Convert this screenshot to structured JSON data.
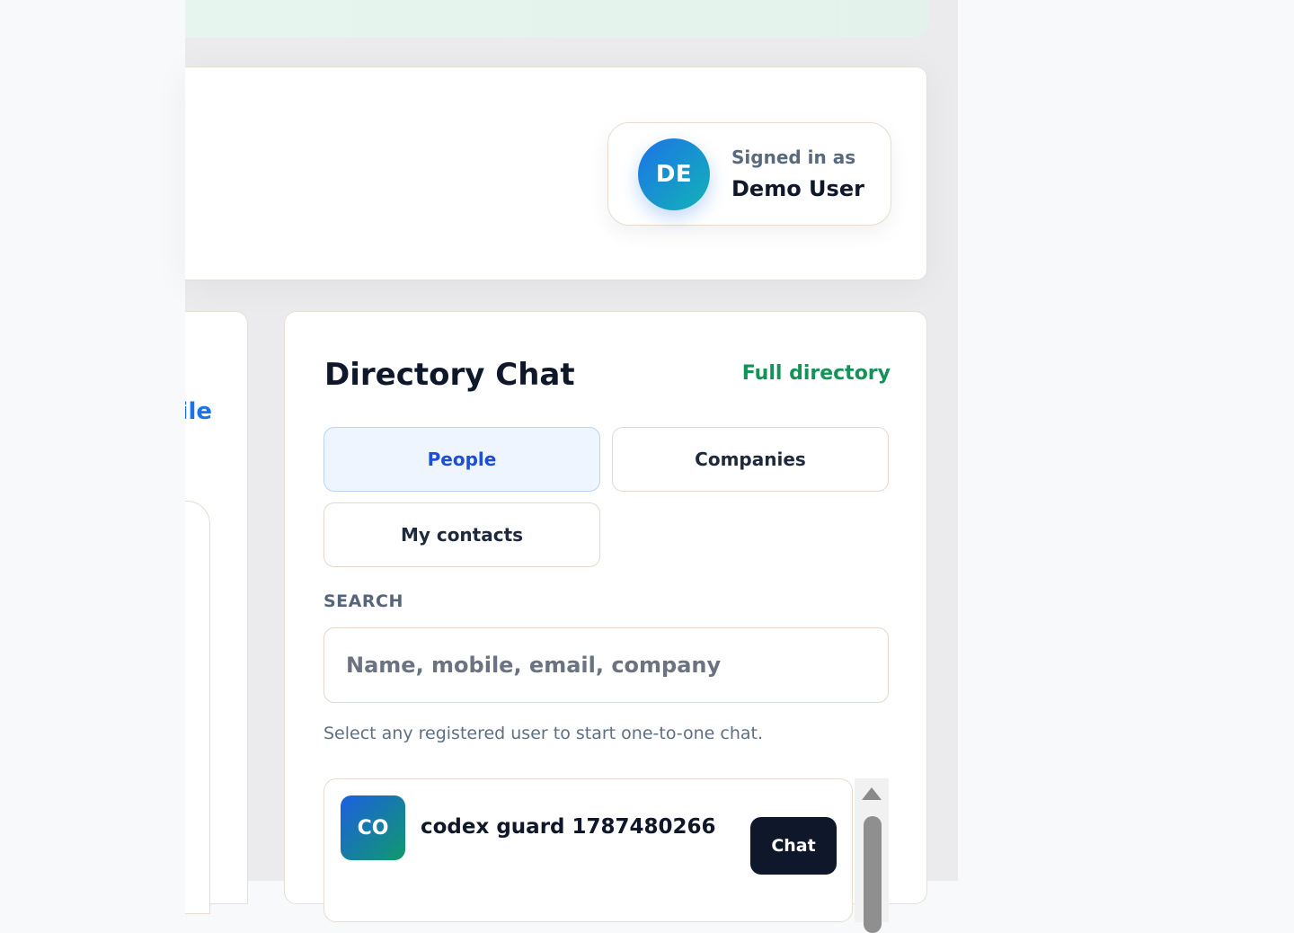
{
  "header": {
    "signed_in_label": "Signed in as",
    "user_name": "Demo User",
    "avatar_initials": "DE"
  },
  "left_panel": {
    "link_text": "ile"
  },
  "directory": {
    "title": "Directory Chat",
    "full_directory_link": "Full directory",
    "tabs": [
      {
        "label": "People",
        "active": true
      },
      {
        "label": "Companies",
        "active": false
      },
      {
        "label": "My contacts",
        "active": false
      }
    ],
    "search_label": "SEARCH",
    "search_placeholder": "Name, mobile, email, company",
    "hint": "Select any registered user to start one-to-one chat.",
    "results": [
      {
        "initials": "CO",
        "name": "codex guard 1787480266",
        "action": "Chat"
      }
    ]
  },
  "colors": {
    "accent_blue": "#1d4ed8",
    "link_green": "#149258",
    "dark_button": "#0f172a"
  }
}
